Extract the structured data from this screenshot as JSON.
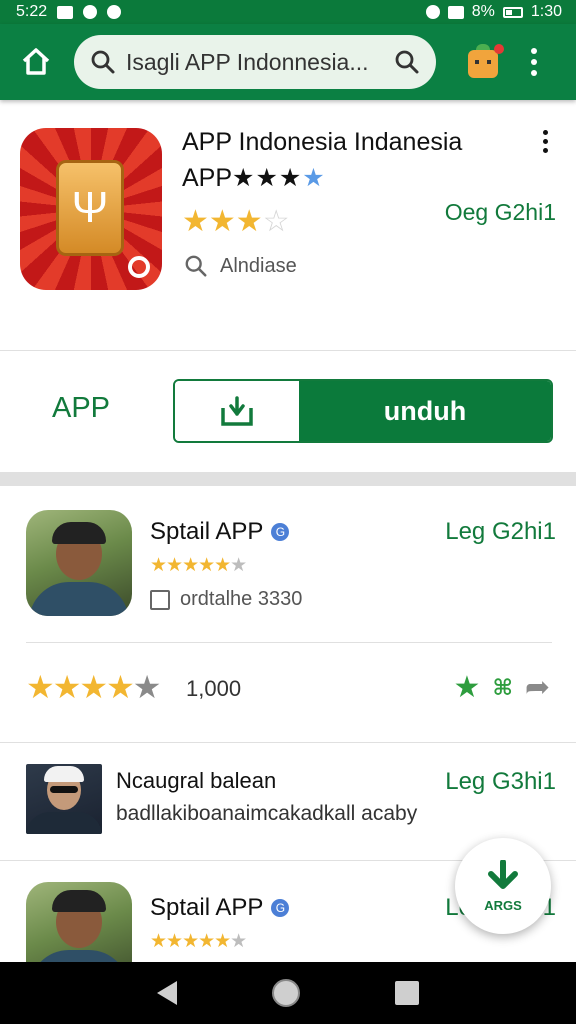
{
  "status_bar": {
    "time": "5:22",
    "battery": "8%",
    "clock": "1:30"
  },
  "app_bar": {
    "search_query": "Isagli APP Indonnesia...",
    "colors": {
      "primary": "#0b8043",
      "status": "#0b7a3b"
    }
  },
  "hero": {
    "title_line1": "APP Indonesia Indanesia",
    "title_line2": "APP",
    "title_stars": "★★★",
    "title_star_blue": "★",
    "rating_on": "★★★",
    "rating_off": "☆",
    "meta": "Oeg G2hi1",
    "developer": "Alndiase",
    "icon_glyph": "Ψ"
  },
  "install": {
    "label": "APP",
    "button_label": "unduh",
    "accent": "#0b7a3b"
  },
  "cards": [
    {
      "title": "Sptail APP",
      "verified": "G",
      "stars_on": "★★★★★",
      "stars_off": "★",
      "meta": "Leg G2hi1",
      "sub": "ordtalhe 3330"
    },
    {
      "title": "Ncaugral balean",
      "meta": "Leg G3hi1",
      "sub": "badllakiboanaimcakadkall acaby"
    },
    {
      "title": "Sptail APP",
      "verified": "G",
      "stars_on": "★★★★★",
      "stars_off": "★",
      "meta": "Leg G2hi1"
    }
  ],
  "stats": {
    "stars_on": "★★★★",
    "stars_half": "★",
    "count": "1,000",
    "action_star": "★",
    "action_grid": "⌘",
    "action_share": "➦"
  },
  "fab": {
    "label": "ARGS"
  }
}
